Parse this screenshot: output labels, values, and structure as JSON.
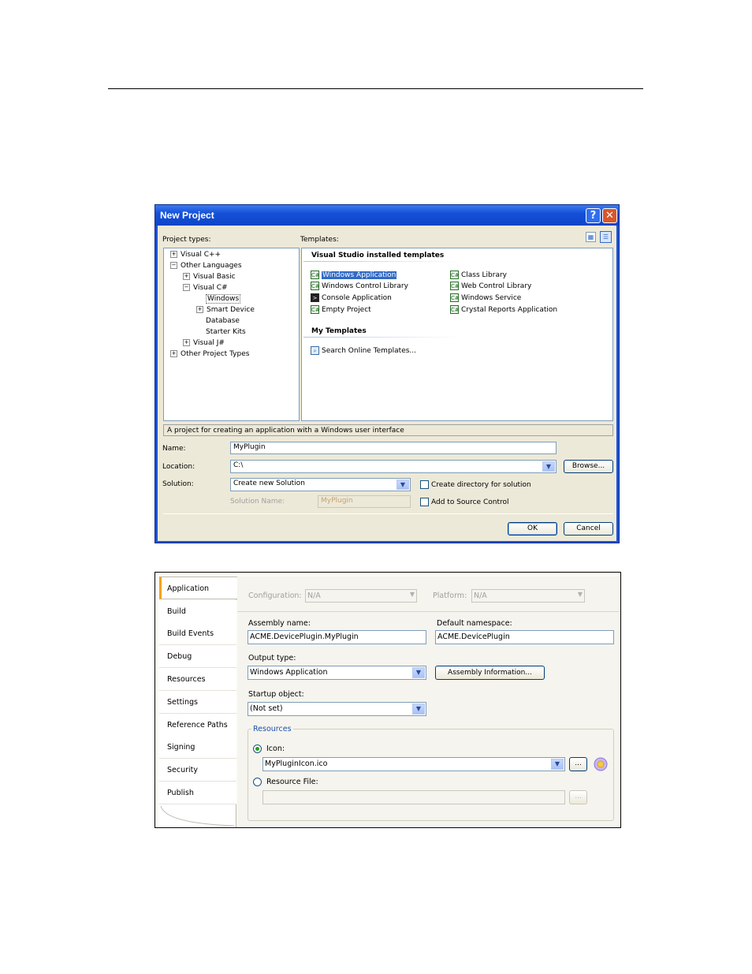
{
  "new_project": {
    "title": "New Project",
    "help_glyph": "?",
    "close_glyph": "✕",
    "project_types_label": "Project types:",
    "templates_label": "Templates:",
    "tree": [
      {
        "label": "Visual C++",
        "expander": "+"
      },
      {
        "label": "Other Languages",
        "expander": "−"
      },
      {
        "label": "Visual Basic",
        "expander": "+"
      },
      {
        "label": "Visual C#",
        "expander": "−"
      },
      {
        "label": "Windows",
        "expander": ""
      },
      {
        "label": "Smart Device",
        "expander": "+"
      },
      {
        "label": "Database",
        "expander": ""
      },
      {
        "label": "Starter Kits",
        "expander": ""
      },
      {
        "label": "Visual J#",
        "expander": "+"
      },
      {
        "label": "Other Project Types",
        "expander": "+"
      }
    ],
    "installed_heading": "Visual Studio installed templates",
    "templates_left": [
      "Windows Application",
      "Windows Control Library",
      "Console Application",
      "Empty Project"
    ],
    "templates_right": [
      "Class Library",
      "Web Control Library",
      "Windows Service",
      "Crystal Reports Application"
    ],
    "my_templates_heading": "My Templates",
    "search_online": "Search Online Templates...",
    "description": "A project for creating an application with a Windows user interface",
    "name_label": "Name:",
    "name_value": "MyPlugin",
    "location_label": "Location:",
    "location_value": "C:\\",
    "browse_label": "Browse...",
    "solution_label": "Solution:",
    "solution_value": "Create new Solution",
    "create_dir_label": "Create directory for solution",
    "solution_name_label": "Solution Name:",
    "solution_name_value": "MyPlugin",
    "source_control_label": "Add to Source Control",
    "ok_label": "OK",
    "cancel_label": "Cancel"
  },
  "project_properties": {
    "tabs": [
      "Application",
      "Build",
      "Build Events",
      "Debug",
      "Resources",
      "Settings",
      "Reference Paths",
      "Signing",
      "Security",
      "Publish"
    ],
    "active_tab": "Application",
    "configuration_label": "Configuration:",
    "configuration_value": "N/A",
    "platform_label": "Platform:",
    "platform_value": "N/A",
    "assembly_name_label": "Assembly name:",
    "assembly_name_value": "ACME.DevicePlugin.MyPlugin",
    "default_namespace_label": "Default namespace:",
    "default_namespace_value": "ACME.DevicePlugin",
    "output_type_label": "Output type:",
    "output_type_value": "Windows Application",
    "assembly_info_label": "Assembly Information...",
    "startup_object_label": "Startup object:",
    "startup_object_value": "(Not set)",
    "resources_group_label": "Resources",
    "icon_label": "Icon:",
    "icon_value": "MyPluginIcon.ico",
    "ellipsis": "...",
    "resource_file_label": "Resource File:",
    "resource_file_value": ""
  }
}
